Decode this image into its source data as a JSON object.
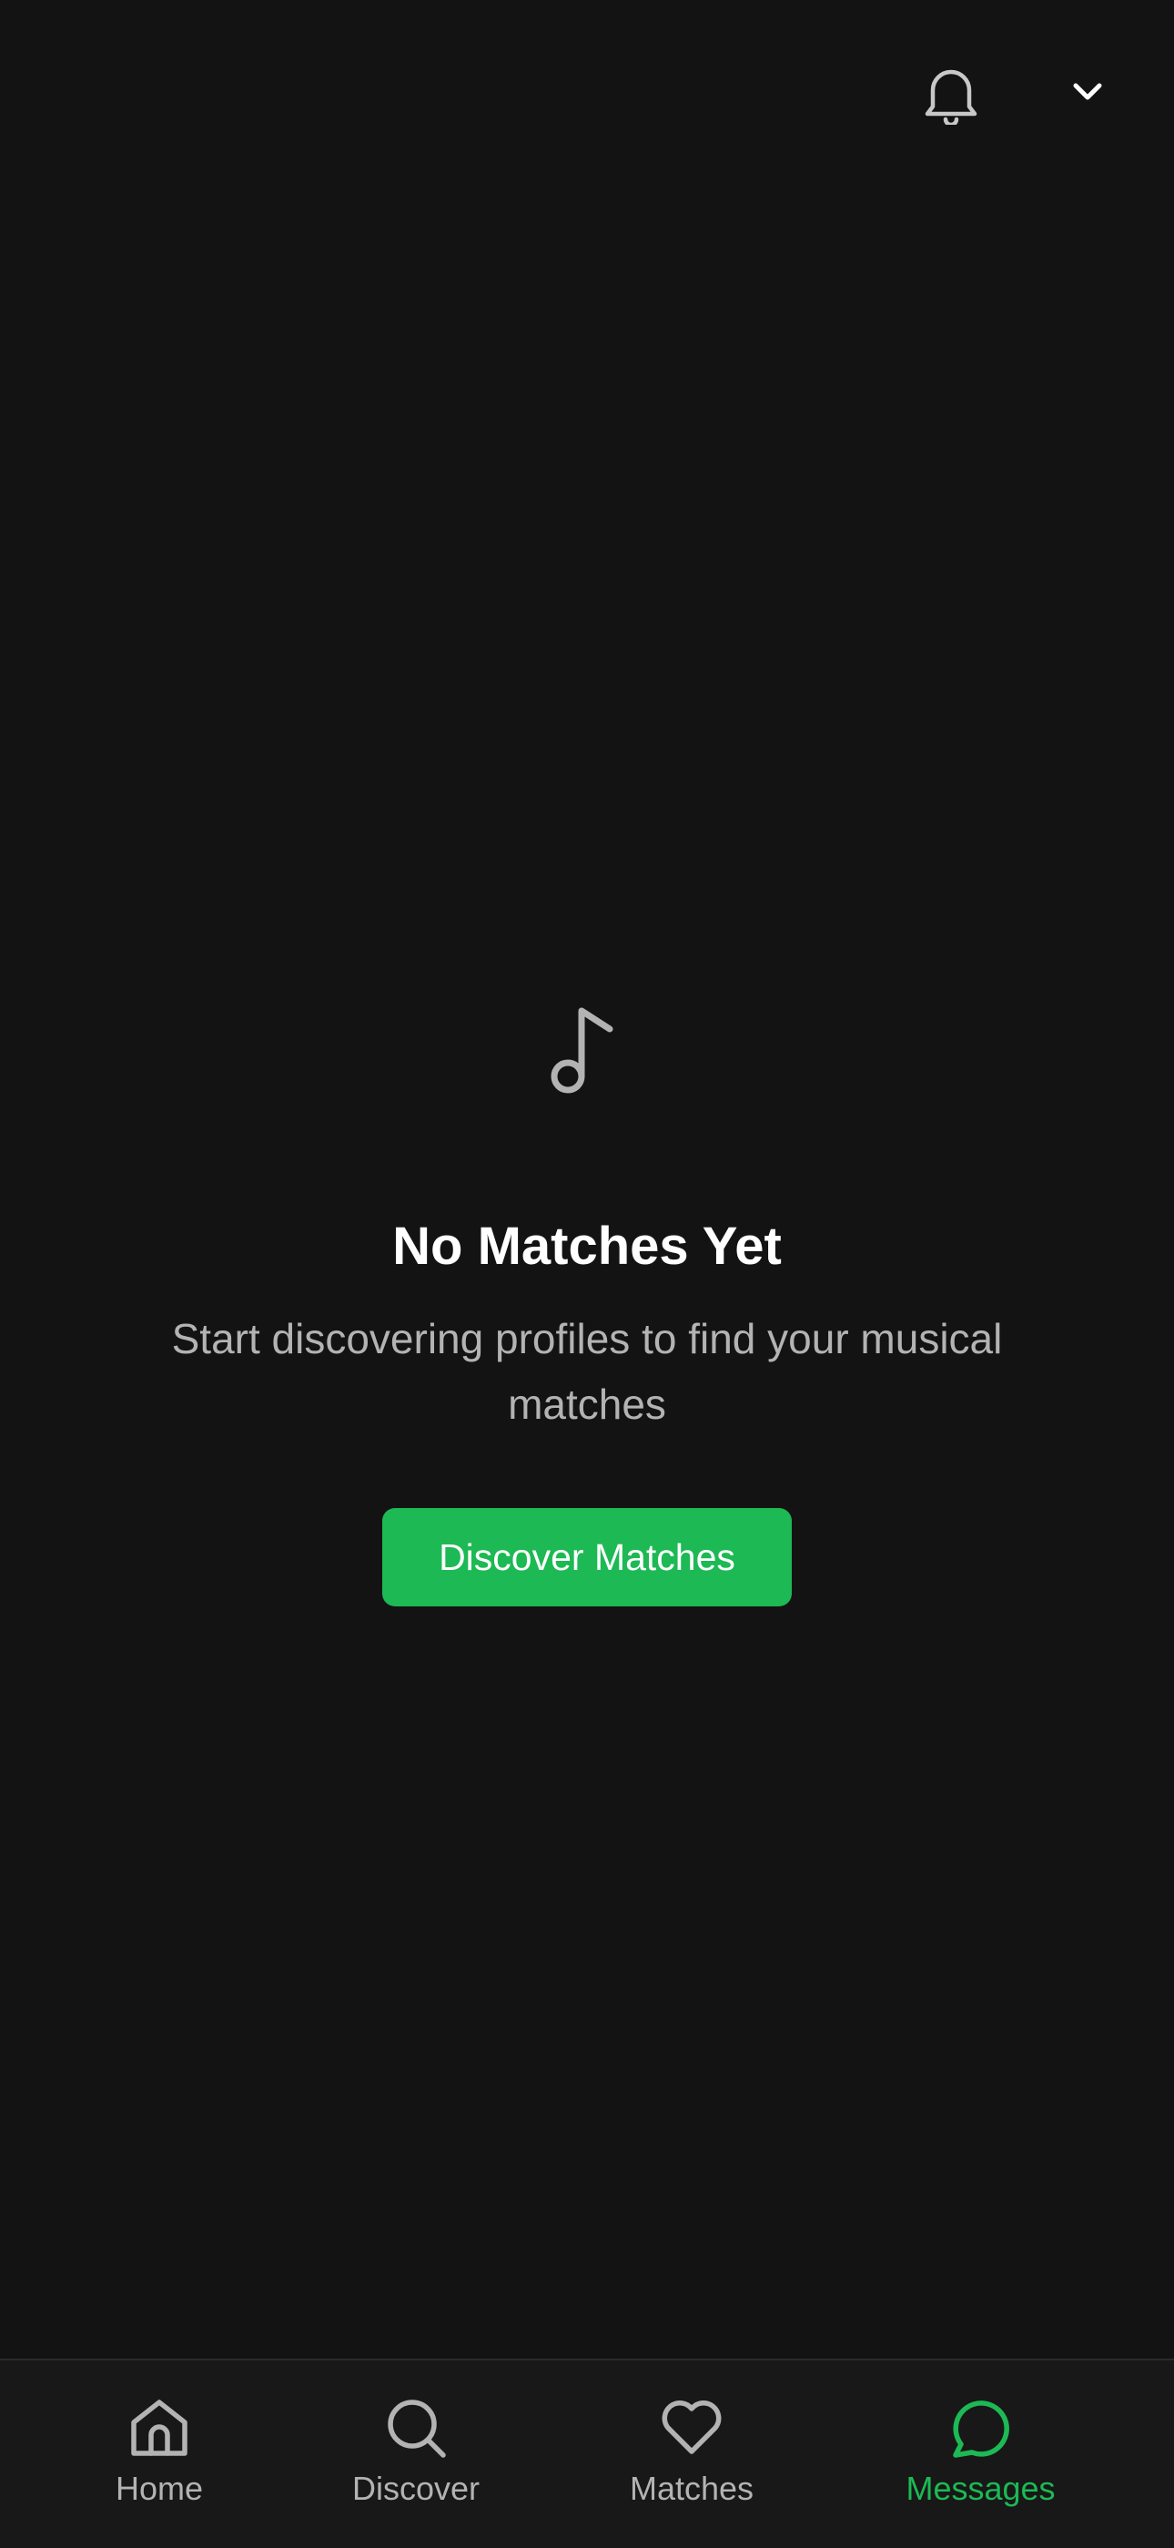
{
  "top_bar": {
    "notifications_icon": "bell-icon",
    "menu_icon": "chevron-down-icon"
  },
  "empty_state": {
    "icon": "music-note-icon",
    "title": "No Matches Yet",
    "subtitle": "Start discovering profiles to find your musical matches",
    "button_label": "Discover Matches"
  },
  "tab_bar": {
    "active": "Messages",
    "tabs": [
      {
        "label": "Home",
        "icon": "home-icon"
      },
      {
        "label": "Discover",
        "icon": "search-icon"
      },
      {
        "label": "Matches",
        "icon": "heart-icon"
      },
      {
        "label": "Messages",
        "icon": "chat-bubble-icon"
      }
    ]
  },
  "colors": {
    "background": "#131313",
    "accent": "#1db954",
    "muted_text": "#b3b3b3",
    "tab_bar_bg": "#181818"
  }
}
